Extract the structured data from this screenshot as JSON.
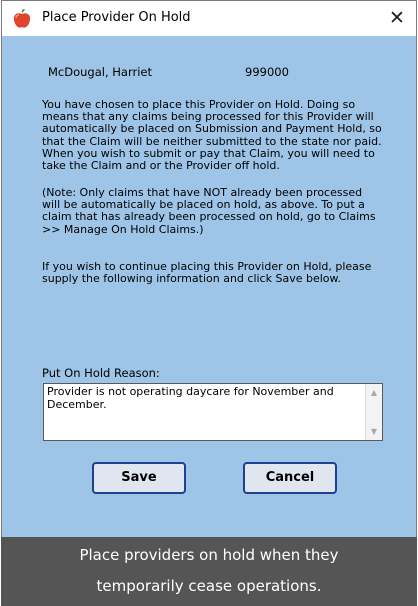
{
  "dialog": {
    "title": "Place Provider On Hold",
    "close_label": "✕"
  },
  "provider": {
    "name": "McDougal, Harriet",
    "id": "999000"
  },
  "paragraphs": [
    "You have chosen to place this Provider on Hold.  Doing so means that any claims being processed for this Provider will automatically be placed on Submission and Payment Hold, so that the Claim will be neither submitted to the state nor paid.  When you wish to submit or pay that Claim, you will need to take the Claim and or the Provider off hold.",
    "(Note: Only claims that have NOT already been processed will be automatically be placed on hold, as above. To put a claim that has already been processed on hold, go to Claims >> Manage On Hold Claims.)",
    "If you wish to continue placing this Provider on Hold, please supply the following information and click Save below."
  ],
  "reason": {
    "label": "Put On Hold Reason:",
    "value": "Provider is not operating daycare for November and December."
  },
  "buttons": {
    "save": "Save",
    "cancel": "Cancel"
  },
  "caption": {
    "line1": "Place providers on hold when they",
    "line2": "temporarily cease operations."
  },
  "icons": {
    "app": "apple-icon",
    "scroll_up": "chevron-up-icon",
    "scroll_down": "chevron-down-icon"
  },
  "colors": {
    "dialog_background": "#9ec5e8",
    "button_border": "#1f3f8f",
    "caption_background": "#555555"
  }
}
